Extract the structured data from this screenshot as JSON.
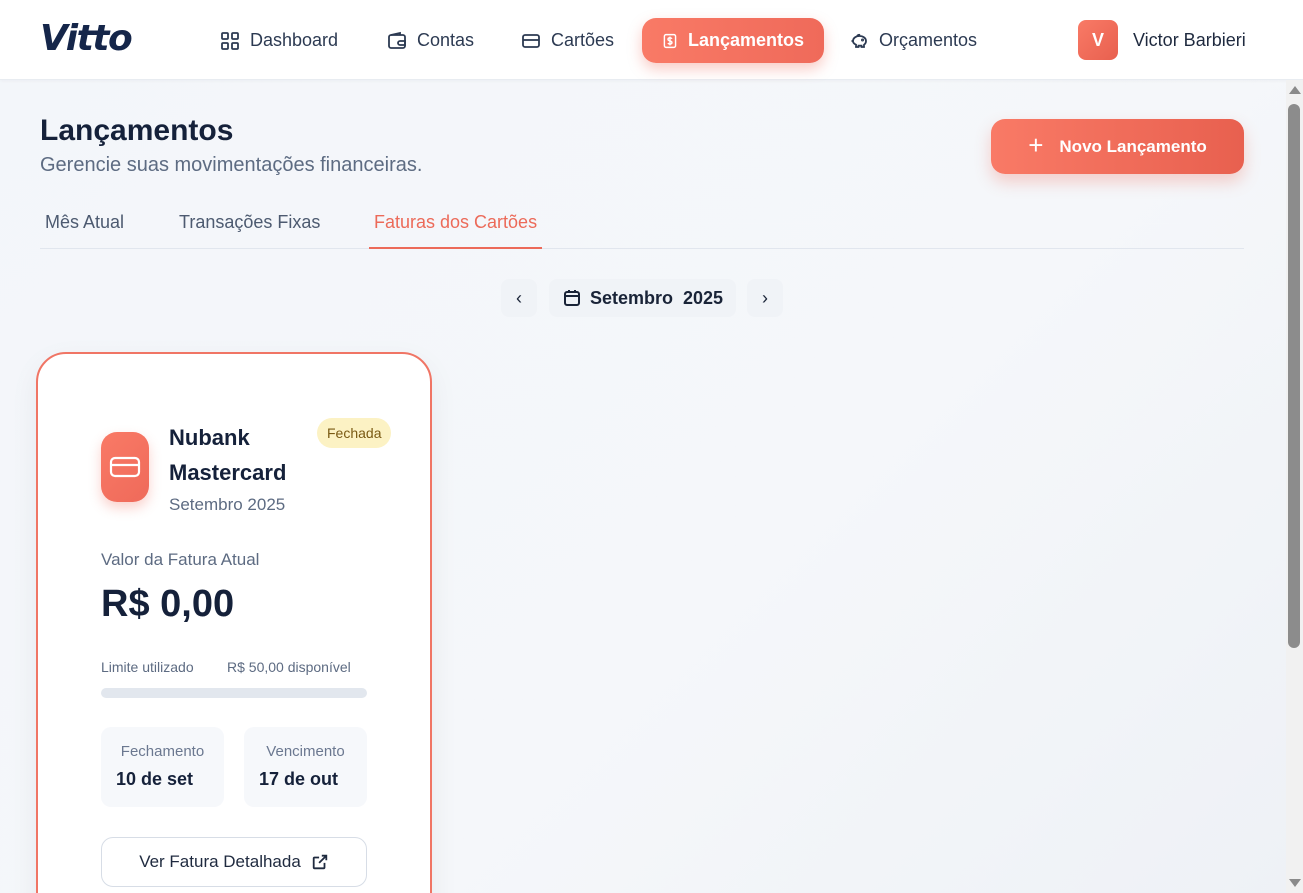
{
  "app": {
    "logo": "Vitto"
  },
  "nav": {
    "items": [
      {
        "label": "Dashboard",
        "icon": "grid-icon"
      },
      {
        "label": "Contas",
        "icon": "wallet-icon"
      },
      {
        "label": "Cartões",
        "icon": "credit-card-icon"
      },
      {
        "label": "Lançamentos",
        "icon": "dollar-icon",
        "active": true
      },
      {
        "label": "Orçamentos",
        "icon": "piggy-bank-icon"
      }
    ]
  },
  "user": {
    "initial": "V",
    "name": "Victor Barbieri"
  },
  "page": {
    "title": "Lançamentos",
    "subtitle": "Gerencie suas movimentações financeiras.",
    "new_button": "Novo Lançamento"
  },
  "tabs": [
    {
      "label": "Mês Atual"
    },
    {
      "label": "Transações Fixas"
    },
    {
      "label": "Faturas dos Cartões",
      "active": true
    }
  ],
  "month_selector": {
    "label": "Setembro  2025",
    "prev": "‹",
    "next": "›"
  },
  "invoice_card": {
    "name": "Nubank Mastercard",
    "period": "Setembro 2025",
    "status": "Fechada",
    "current_label": "Valor da Fatura Atual",
    "amount": "R$ 0,00",
    "limit_label": "Limite utilizado",
    "limit_available": "R$ 50,00 disponível",
    "limit_used_fraction": 0,
    "closing_title": "Fechamento",
    "closing_value": "10 de set",
    "due_title": "Vencimento",
    "due_value": "17 de out",
    "detail_button": "Ver Fatura Detalhada"
  },
  "colors": {
    "accent": "#ef6a5a",
    "navy": "#15213a",
    "badge_bg": "#fcf2c4"
  }
}
